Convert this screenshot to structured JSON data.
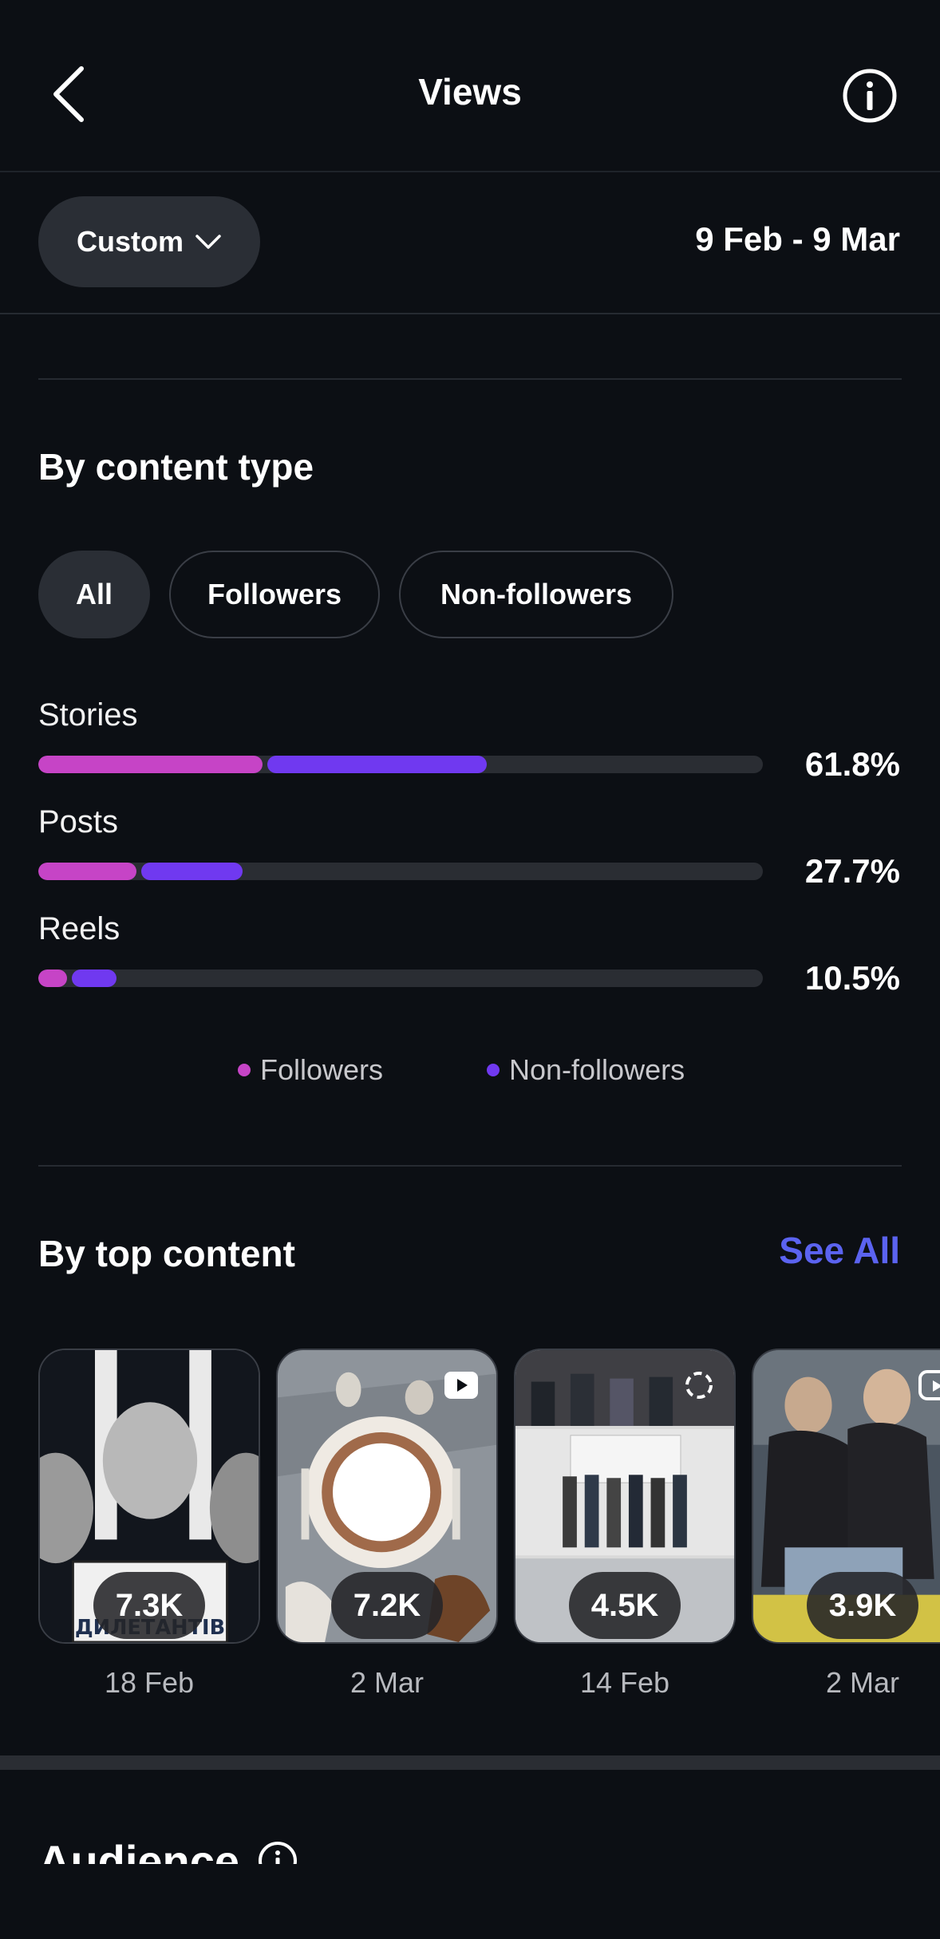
{
  "header": {
    "title": "Views",
    "back_icon": "chevron-left-icon",
    "info_icon": "info-icon"
  },
  "filter": {
    "period_label": "Custom",
    "date_range": "9 Feb - 9 Mar"
  },
  "content_type": {
    "title": "By content type",
    "tabs": [
      {
        "label": "All",
        "active": true
      },
      {
        "label": "Followers",
        "active": false
      },
      {
        "label": "Non-followers",
        "active": false
      }
    ],
    "rows": [
      {
        "label": "Stories",
        "percent": "61.8%",
        "followers_fraction": 0.31,
        "non_followers_fraction": 0.31
      },
      {
        "label": "Posts",
        "percent": "27.7%",
        "followers_fraction": 0.135,
        "non_followers_fraction": 0.146
      },
      {
        "label": "Reels",
        "percent": "10.5%",
        "followers_fraction": 0.04,
        "non_followers_fraction": 0.068
      }
    ],
    "legend": [
      {
        "label": "Followers",
        "color": "#c644c6"
      },
      {
        "label": "Non-followers",
        "color": "#7039f0"
      }
    ]
  },
  "top_content": {
    "title": "By top content",
    "see_all": "See All",
    "items": [
      {
        "views": "7.3K",
        "date": "18 Feb",
        "caption": "ДИЛЕТАНТІВ"
      },
      {
        "views": "7.2K",
        "date": "2 Mar"
      },
      {
        "views": "4.5K",
        "date": "14 Feb"
      },
      {
        "views": "3.9K",
        "date": "2 Mar"
      }
    ]
  },
  "audience": {
    "title": "Audience"
  },
  "colors": {
    "background": "#0c0f14",
    "followers": "#c644c6",
    "non_followers": "#7039f0",
    "accent_link": "#5b63f0"
  }
}
